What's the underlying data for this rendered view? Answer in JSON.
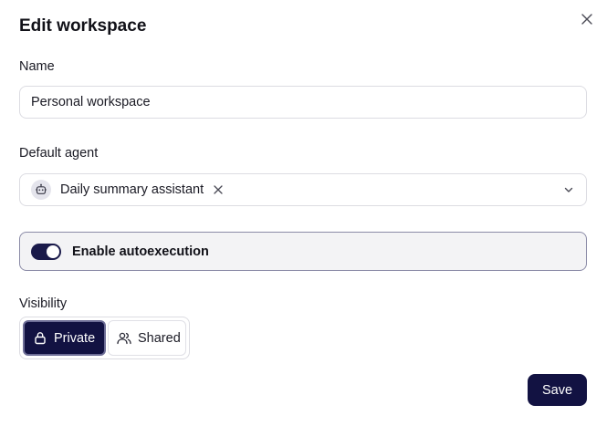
{
  "dialog": {
    "title": "Edit workspace",
    "close_icon": "close-icon"
  },
  "name_field": {
    "label": "Name",
    "value": "Personal workspace"
  },
  "agent_field": {
    "label": "Default agent",
    "selected": "Daily summary assistant",
    "avatar_icon": "robot-icon",
    "remove_icon": "close-icon",
    "chevron_icon": "chevron-down-icon"
  },
  "autoexecution": {
    "label": "Enable autoexecution",
    "enabled": true
  },
  "visibility": {
    "label": "Visibility",
    "options": [
      {
        "label": "Private",
        "icon": "lock-icon",
        "selected": true
      },
      {
        "label": "Shared",
        "icon": "users-icon",
        "selected": false
      }
    ]
  },
  "actions": {
    "save_label": "Save"
  },
  "colors": {
    "primary": "#121242",
    "border": "#dcdce2",
    "toggle_bg": "#f3f3f5"
  }
}
